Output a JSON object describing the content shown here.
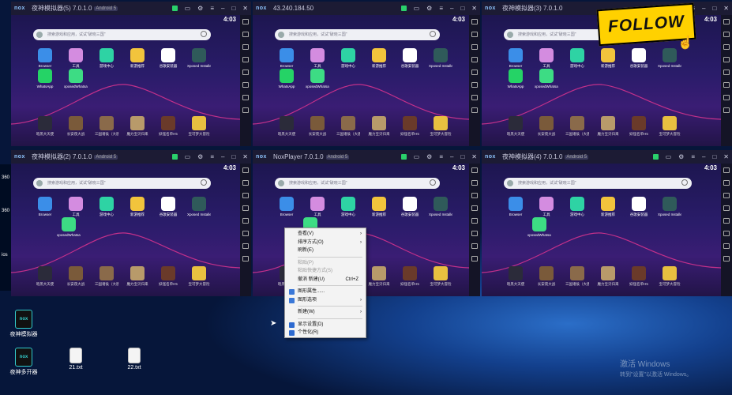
{
  "desktop": {
    "icons": [
      {
        "label": "夜神模拟器",
        "glyph": "nox"
      },
      {
        "label": "夜神多开器",
        "glyph": "nox"
      },
      {
        "label": "21.txt",
        "glyph": ""
      },
      {
        "label": "22.txt",
        "glyph": ""
      }
    ],
    "left_strip": [
      "360",
      "360",
      "ios",
      ""
    ]
  },
  "windows": [
    {
      "title": "夜神模拟器(5) 7.0.1.0",
      "android": "Android 5",
      "time": "4:03",
      "show_second_row": true
    },
    {
      "title": "43.240.184.50",
      "android": "",
      "time": "4:03",
      "show_second_row": true
    },
    {
      "title": "夜神模拟器(3) 7.0.1.0",
      "android": "",
      "time": "4:03",
      "show_second_row": true
    },
    {
      "title": "夜神模拟器(2) 7.0.1.0",
      "android": "Android 5",
      "time": "4:03",
      "show_second_row": false
    },
    {
      "title": "NoxPlayer 7.0.1.0",
      "android": "Android 5",
      "time": "4:03",
      "show_second_row": false
    },
    {
      "title": "夜神模拟器(4) 7.0.1.0",
      "android": "Android 5",
      "time": "4:03",
      "show_second_row": false
    }
  ],
  "emulator": {
    "logo": "nox",
    "search_placeholder": "搜索游戏和应用，试试\"破晓三国\"",
    "apps": [
      {
        "label": "Browser",
        "color": "#3b8ee8"
      },
      {
        "label": "工具",
        "color": "#d48ce0"
      },
      {
        "label": "游戏中心",
        "color": "#2ed3a4"
      },
      {
        "label": "新游推荐",
        "color": "#f2c43c"
      },
      {
        "label": "谷歌安装器",
        "color": "#ffffff"
      },
      {
        "label": "Xposed Installer",
        "color": "#2f5a5a"
      }
    ],
    "second_row": [
      {
        "label": "WhatsApp",
        "color": "#25d366"
      },
      {
        "label": "xposedWhatsapp",
        "color": "#3ddc84"
      }
    ],
    "second_row_alt": {
      "label": "xposedWhatsapp",
      "color": "#3ddc84"
    },
    "games": [
      {
        "label": "暗黑大天使",
        "color": "#2b2b3a"
      },
      {
        "label": "长安夜大战",
        "color": "#7a5a3a"
      },
      {
        "label": "三国诸侯（大唐）",
        "color": "#8a6a4a"
      },
      {
        "label": "魔力宝贝归来",
        "color": "#b89a6a"
      },
      {
        "label": "妖怪名单H5",
        "color": "#6a3a2a"
      },
      {
        "label": "宝可梦大冒险",
        "color": "#e8c040"
      }
    ]
  },
  "context_menu": {
    "items": [
      {
        "label": "查看(V)",
        "arrow": "›",
        "shortcut": "",
        "disabled": false,
        "icon": ""
      },
      {
        "label": "排序方式(O)",
        "arrow": "›",
        "shortcut": "",
        "disabled": false,
        "icon": ""
      },
      {
        "label": "刷新(E)",
        "arrow": "",
        "shortcut": "",
        "disabled": false,
        "icon": ""
      },
      {
        "sep": true
      },
      {
        "label": "粘贴(P)",
        "arrow": "",
        "shortcut": "",
        "disabled": true,
        "icon": ""
      },
      {
        "label": "粘贴快捷方式(S)",
        "arrow": "",
        "shortcut": "",
        "disabled": true,
        "icon": ""
      },
      {
        "label": "撤消 新建(U)",
        "arrow": "",
        "shortcut": "Ctrl+Z",
        "disabled": false,
        "icon": ""
      },
      {
        "sep": true
      },
      {
        "label": "图形属性......",
        "arrow": "",
        "shortcut": "",
        "disabled": false,
        "icon": "#3a78d8"
      },
      {
        "label": "图形选项",
        "arrow": "›",
        "shortcut": "",
        "disabled": false,
        "icon": "#3a78d8"
      },
      {
        "sep": true
      },
      {
        "label": "新建(W)",
        "arrow": "›",
        "shortcut": "",
        "disabled": false,
        "icon": ""
      },
      {
        "sep": true
      },
      {
        "label": "显示设置(D)",
        "arrow": "",
        "shortcut": "",
        "disabled": false,
        "icon": "#2d6ad0"
      },
      {
        "label": "个性化(R)",
        "arrow": "",
        "shortcut": "",
        "disabled": false,
        "icon": "#2d6ad0"
      }
    ]
  },
  "overlay": {
    "follow_text": "FOLLOW"
  },
  "watermark": {
    "line1": "激活 Windows",
    "line2": "转到\"设置\"以激活 Windows。"
  }
}
